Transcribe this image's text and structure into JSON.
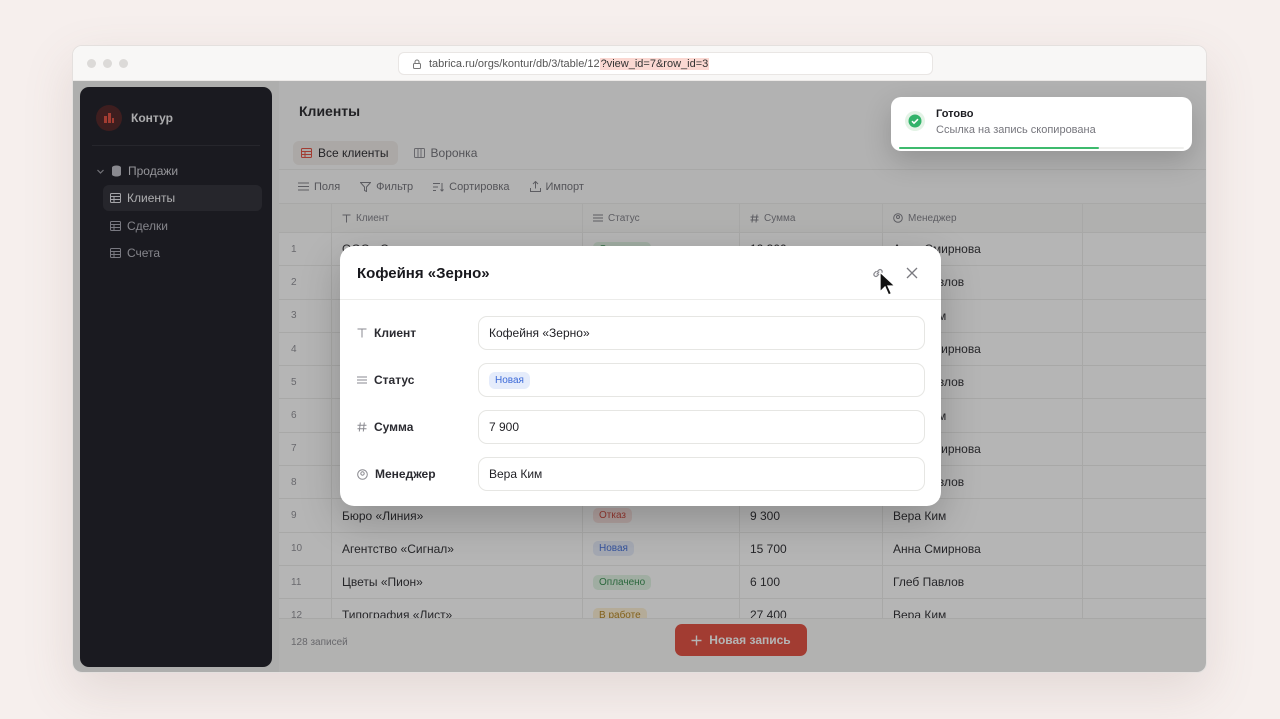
{
  "browser": {
    "url_base": "tabrica.ru/orgs/kontur/db/3/table/12",
    "url_query": "?view_id=7&row_id=3"
  },
  "sidebar": {
    "brand": "Контур",
    "group": "Продажи",
    "items": [
      {
        "label": "Клиенты",
        "active": true
      },
      {
        "label": "Сделки",
        "active": false
      },
      {
        "label": "Счета",
        "active": false
      }
    ]
  },
  "page": {
    "title": "Клиенты",
    "views": [
      {
        "label": "Все клиенты",
        "active": true
      },
      {
        "label": "Воронка",
        "active": false
      }
    ],
    "toolbar": {
      "fields": "Поля",
      "filter": "Фильтр",
      "sort": "Сортировка",
      "import": "Импорт"
    }
  },
  "table": {
    "columns": [
      "Клиент",
      "Статус",
      "Сумма",
      "Менеджер"
    ],
    "rows": [
      {
        "n": "1",
        "client": "ООО «Север»",
        "status": "Оплачено",
        "sum": "12 300",
        "manager": "Анна Смирнова"
      },
      {
        "n": "2",
        "client": "",
        "status": "",
        "sum": "",
        "manager": "Глеб Павлов"
      },
      {
        "n": "3",
        "client": "",
        "status": "",
        "sum": "",
        "manager": "Вера Ким"
      },
      {
        "n": "4",
        "client": "",
        "status": "",
        "sum": "",
        "manager": "Анна Смирнова"
      },
      {
        "n": "5",
        "client": "",
        "status": "",
        "sum": "",
        "manager": "Глеб Павлов"
      },
      {
        "n": "6",
        "client": "",
        "status": "",
        "sum": "",
        "manager": "Вера Ким"
      },
      {
        "n": "7",
        "client": "",
        "status": "",
        "sum": "",
        "manager": "Анна Смирнова"
      },
      {
        "n": "8",
        "client": "",
        "status": "",
        "sum": "",
        "manager": "Глеб Павлов"
      },
      {
        "n": "9",
        "client": "Бюро «Линия»",
        "status": "Отказ",
        "sum": "9 300",
        "manager": "Вера Ким"
      },
      {
        "n": "10",
        "client": "Агентство «Сигнал»",
        "status": "Новая",
        "sum": "15 700",
        "manager": "Анна Смирнова"
      },
      {
        "n": "11",
        "client": "Цветы «Пион»",
        "status": "Оплачено",
        "sum": "6 100",
        "manager": "Глеб Павлов"
      },
      {
        "n": "12",
        "client": "Типография «Лист»",
        "status": "В работе",
        "sum": "27 400",
        "manager": "Вера Ким"
      }
    ],
    "status_colors": {
      "Оплачено": {
        "bg": "#dff3e2",
        "fg": "#2f8a4a"
      },
      "Новая": {
        "bg": "#e5ecfb",
        "fg": "#3d6ad8"
      },
      "Отказ": {
        "bg": "#fbe3e0",
        "fg": "#d24437"
      },
      "В работе": {
        "bg": "#fdf0d3",
        "fg": "#b07e16"
      }
    }
  },
  "footer": {
    "count": "128 записей",
    "new_record": "Новая запись"
  },
  "modal": {
    "title": "Кофейня «Зерно»",
    "fields": [
      {
        "label": "Клиент",
        "value": "Кофейня «Зерно»"
      },
      {
        "label": "Статус",
        "value": "Новая"
      },
      {
        "label": "Сумма",
        "value": "7 900"
      },
      {
        "label": "Менеджер",
        "value": "Вера Ким"
      }
    ]
  },
  "toast": {
    "title": "Готово",
    "text": "Ссылка на запись скопирована",
    "progress": 0.7
  },
  "colors": {
    "accent": "#e34839",
    "sidebar_bg": "#15151d",
    "success": "#3dba6d"
  }
}
